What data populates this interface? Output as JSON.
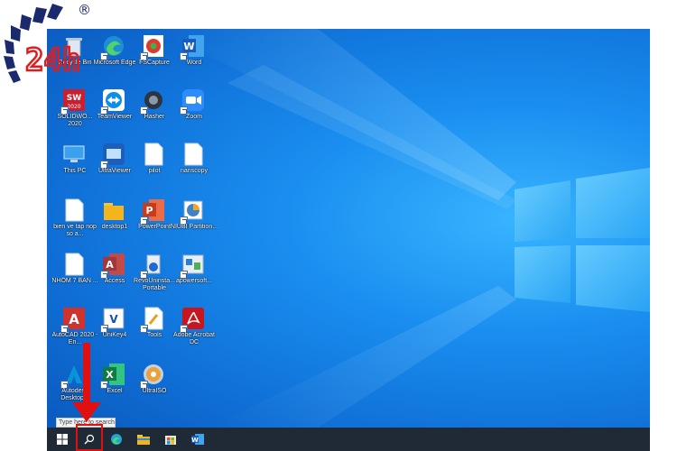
{
  "watermark": {
    "logo_text": "24h",
    "registered_mark": "®",
    "colors": {
      "primary": "#1a2a6c",
      "accent": "#e01d1d"
    }
  },
  "desktop": {
    "wallpaper": "windows-10-light-beams",
    "icons": [
      {
        "label": "Recycle Bin",
        "icon": "recycle-bin-icon"
      },
      {
        "label": "Microsoft Edge",
        "icon": "edge-icon"
      },
      {
        "label": "FSCapture",
        "icon": "fscapture-icon"
      },
      {
        "label": "Word",
        "icon": "word-icon"
      },
      {
        "label": "SOLIDWO... 2020",
        "icon": "solidworks-icon"
      },
      {
        "label": "TeamViewer",
        "icon": "teamviewer-icon"
      },
      {
        "label": "Hasher",
        "icon": "hasher-icon"
      },
      {
        "label": "Zoom",
        "icon": "zoom-icon"
      },
      {
        "label": "This PC",
        "icon": "this-pc-icon"
      },
      {
        "label": "UltraViewer",
        "icon": "ultraviewer-icon"
      },
      {
        "label": "pilot",
        "icon": "file-icon"
      },
      {
        "label": "nanscopy",
        "icon": "file-icon"
      },
      {
        "label": "bien ve tap nop so a...",
        "icon": "file-icon"
      },
      {
        "label": "desktop1",
        "icon": "folder-icon"
      },
      {
        "label": "PowerPoint",
        "icon": "powerpoint-icon"
      },
      {
        "label": "NIUBI Partition...",
        "icon": "niubi-icon"
      },
      {
        "label": "NHOM 7 BAN ...",
        "icon": "file-icon"
      },
      {
        "label": "Access",
        "icon": "access-icon"
      },
      {
        "label": "RevoUninsta... Portable",
        "icon": "revo-uninstaller-icon"
      },
      {
        "label": "apowersoft...",
        "icon": "apowersoft-icon"
      },
      {
        "label": "AutoCAD 2020 - En...",
        "icon": "autocad-icon"
      },
      {
        "label": "UniKey4",
        "icon": "unikey-icon"
      },
      {
        "label": "Tools",
        "icon": "tools-icon"
      },
      {
        "label": "Adobe Acrobat DC",
        "icon": "acrobat-icon"
      },
      {
        "label": "Autodesk Desktop...",
        "icon": "autodesk-icon"
      },
      {
        "label": "Excel",
        "icon": "excel-icon"
      },
      {
        "label": "UltraISO",
        "icon": "ultraiso-icon"
      }
    ]
  },
  "taskbar": {
    "search_tooltip": "Type here to search",
    "items": [
      {
        "name": "start-button",
        "icon": "windows-icon"
      },
      {
        "name": "search-button",
        "icon": "search-icon"
      },
      {
        "name": "taskbar-edge",
        "icon": "edge-icon"
      },
      {
        "name": "taskbar-file-explorer",
        "icon": "folder-icon"
      },
      {
        "name": "taskbar-store",
        "icon": "store-icon"
      },
      {
        "name": "taskbar-word",
        "icon": "word-icon"
      }
    ]
  },
  "annotation": {
    "color": "#e01010",
    "target": "search-button"
  }
}
